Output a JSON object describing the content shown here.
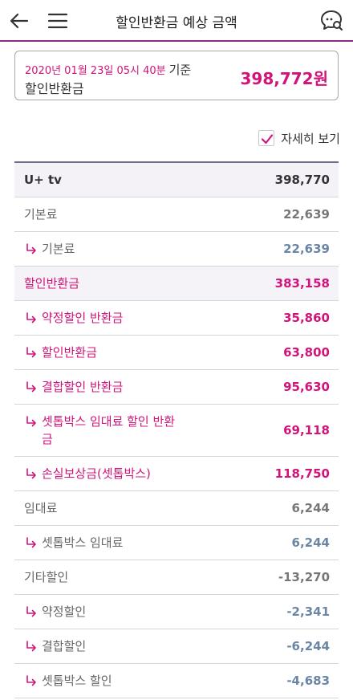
{
  "header": {
    "title": "할인반환금 예상 금액",
    "back_icon": "arrow-left-icon",
    "menu_icon": "hamburger-menu-icon",
    "chat_icon": "chat-search-icon",
    "accent_color": "#8c2b84"
  },
  "summary": {
    "date": "2020년 01월 23일 05시 40분",
    "reference": "기준",
    "label": "할인반환금",
    "amount": "398,772원",
    "amount_color": "#d1147a"
  },
  "detail_toggle": {
    "label": "자세히 보기",
    "checked": true
  },
  "rows": [
    {
      "label": "U+ tv",
      "value": "398,770"
    },
    {
      "label": "기본료",
      "value": "22,639"
    },
    {
      "label": "기본료",
      "value": "22,639"
    },
    {
      "label": "할인반환금",
      "value": "383,158"
    },
    {
      "label": "약정할인 반환금",
      "value": "35,860"
    },
    {
      "label": "할인반환금",
      "value": "63,800"
    },
    {
      "label": "결합할인 반환금",
      "value": "95,630"
    },
    {
      "label": "셋톱박스 임대료 할인 반환금",
      "value": "69,118"
    },
    {
      "label": "손실보상금(셋톱박스)",
      "value": "118,750"
    },
    {
      "label": "임대료",
      "value": "6,244"
    },
    {
      "label": "셋톱박스 임대료",
      "value": "6,244"
    },
    {
      "label": "기타할인",
      "value": "-13,270"
    },
    {
      "label": "약정할인",
      "value": "-2,341"
    },
    {
      "label": "결합할인",
      "value": "-6,244"
    },
    {
      "label": "셋톱박스 할인",
      "value": "-4,683"
    }
  ]
}
